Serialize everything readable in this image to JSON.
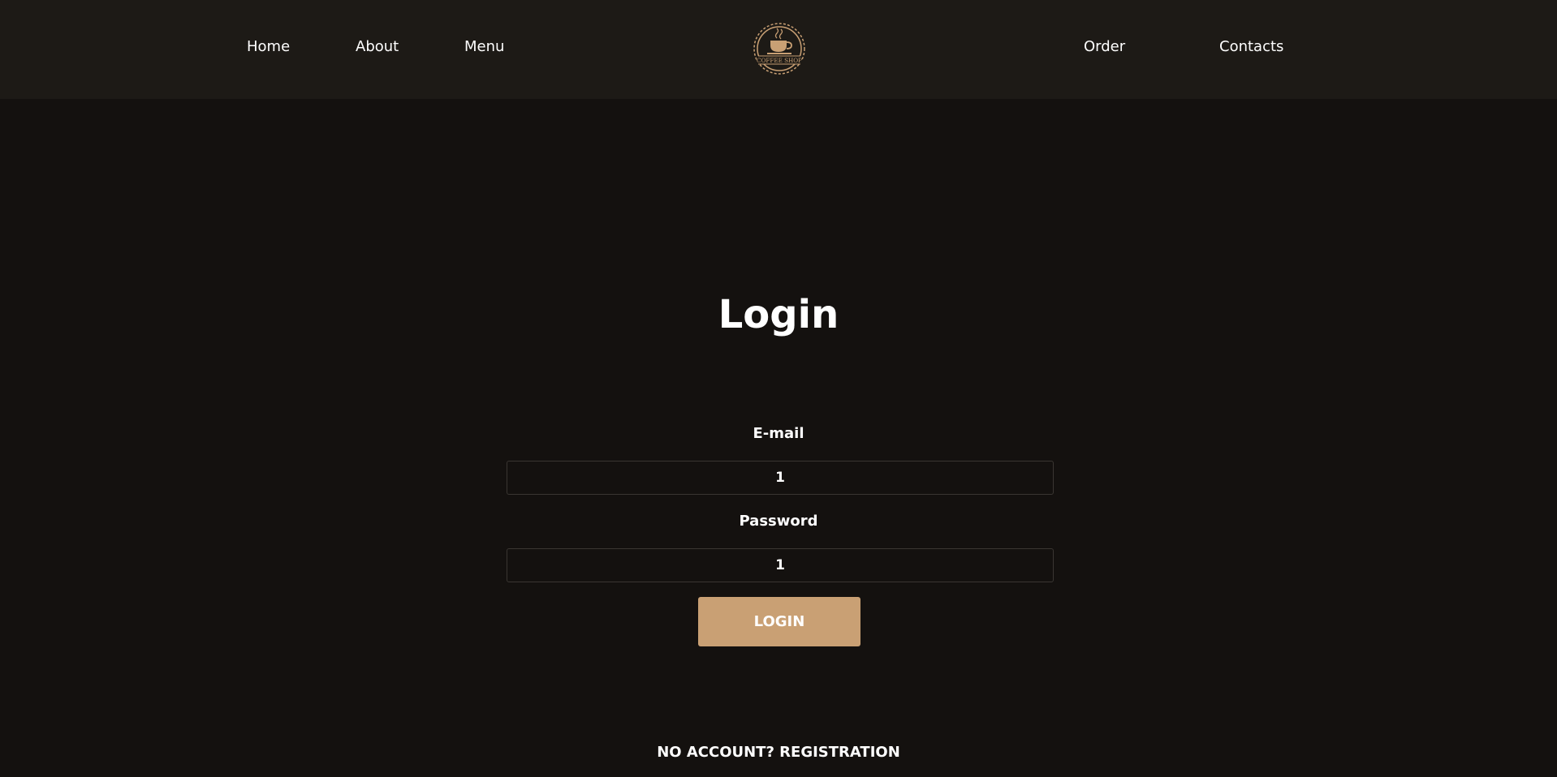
{
  "nav": {
    "home": "Home",
    "about": "About",
    "menu": "Menu",
    "order": "Order",
    "contacts": "Contacts"
  },
  "logo": {
    "text": "COFFEE SHOP",
    "icon": "coffee-cup-icon",
    "color": "#c9a074"
  },
  "login": {
    "title": "Login",
    "email_label": "E-mail",
    "email_value": "1",
    "password_label": "Password",
    "password_value": "1",
    "button_label": "LOGIN",
    "register_link": "NO ACCOUNT? REGISTRATION"
  },
  "colors": {
    "background": "#14110f",
    "header": "#1d1a16",
    "accent": "#c9a074"
  }
}
